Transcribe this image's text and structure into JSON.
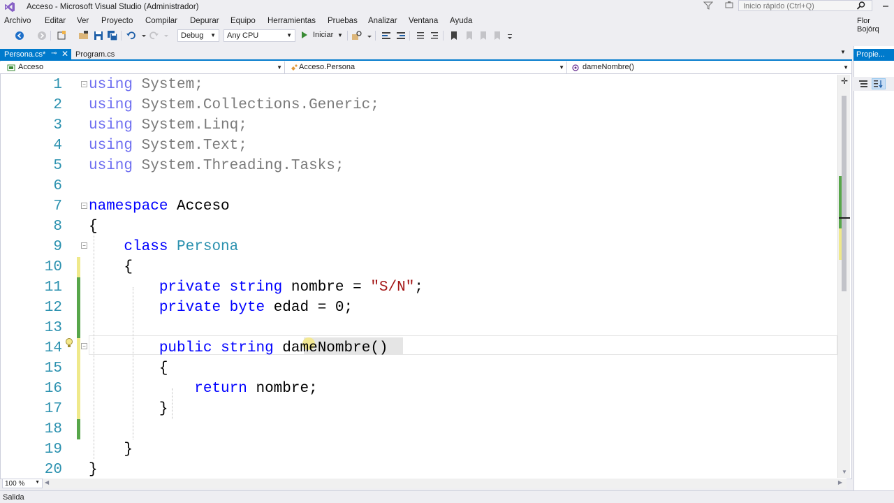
{
  "window": {
    "title": "Acceso - Microsoft Visual Studio  (Administrador)",
    "quick_launch_placeholder": "Inicio rápido (Ctrl+Q)",
    "user": "Flor Bojórq"
  },
  "menu": [
    "Archivo",
    "Editar",
    "Ver",
    "Proyecto",
    "Compilar",
    "Depurar",
    "Equipo",
    "Herramientas",
    "Pruebas",
    "Analizar",
    "Ventana",
    "Ayuda"
  ],
  "toolbar": {
    "configuration": "Debug",
    "platform": "Any CPU",
    "start_label": "Iniciar"
  },
  "tabs": [
    {
      "label": "Persona.cs*",
      "active": true
    },
    {
      "label": "Program.cs",
      "active": false
    }
  ],
  "navbar": {
    "project": "Acceso",
    "type": "Acceso.Persona",
    "member": "dameNombre()"
  },
  "code_lines": [
    {
      "n": "1",
      "text": "using System;"
    },
    {
      "n": "2",
      "text": "using System.Collections.Generic;"
    },
    {
      "n": "3",
      "text": "using System.Linq;"
    },
    {
      "n": "4",
      "text": "using System.Text;"
    },
    {
      "n": "5",
      "text": "using System.Threading.Tasks;"
    },
    {
      "n": "6",
      "text": ""
    },
    {
      "n": "7",
      "text": "namespace Acceso"
    },
    {
      "n": "8",
      "text": "{"
    },
    {
      "n": "9",
      "text": "    class Persona"
    },
    {
      "n": "10",
      "text": "    {"
    },
    {
      "n": "11",
      "text": "        private string nombre = \"S/N\";"
    },
    {
      "n": "12",
      "text": "        private byte edad = 0;"
    },
    {
      "n": "13",
      "text": ""
    },
    {
      "n": "14",
      "text": "        public string dameNombre()"
    },
    {
      "n": "15",
      "text": "        {"
    },
    {
      "n": "16",
      "text": "            return nombre;"
    },
    {
      "n": "17",
      "text": "        }"
    },
    {
      "n": "18",
      "text": ""
    },
    {
      "n": "19",
      "text": "    }"
    },
    {
      "n": "20",
      "text": "}"
    }
  ],
  "code_tokens": {
    "using": "using",
    "System": "System;",
    "SysColl": "System.Collections.Generic;",
    "SysLinq": "System.Linq;",
    "SysText": "System.Text;",
    "SysTasks": "System.Threading.Tasks;",
    "namespace": "namespace",
    "ns_name": "Acceso",
    "class": "class",
    "class_name": "Persona",
    "private": "private",
    "string": "string",
    "byte": "byte",
    "public": "public",
    "return": "return",
    "nombre_decl": "nombre = ",
    "sn": "\"S/N\"",
    "semi": ";",
    "edad_decl": "edad = 0;",
    "method": "dameNombre",
    "parens": "()",
    "return_expr": "nombre;",
    "open_brace": "{",
    "close_brace": "}"
  },
  "zoom": "100 %",
  "properties_tab": "Propie...",
  "output_label": "Salida",
  "colors": {
    "accent": "#007acc",
    "keyword": "#0000ff",
    "type": "#2b91af",
    "string": "#a31515",
    "saved_change": "#57a64a",
    "unsaved_change": "#efe98a"
  }
}
